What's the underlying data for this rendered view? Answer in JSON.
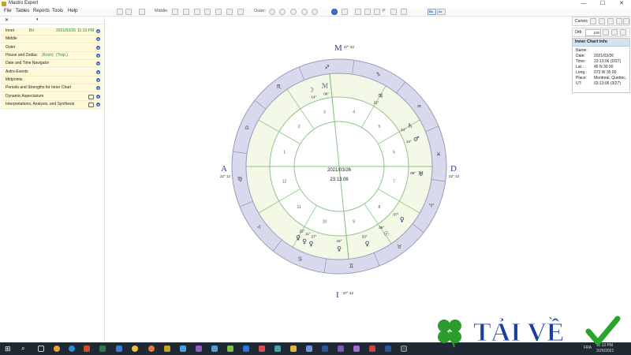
{
  "window": {
    "title": "Mastro Expert",
    "controls": [
      "—",
      "☐",
      "✕"
    ]
  },
  "menu": [
    "File",
    "Tables",
    "Reports",
    "Tools",
    "Help"
  ],
  "toolbar": {
    "middle_label": "Middle:",
    "outer_label": "Outer:",
    "page_label": "P",
    "zoom_a": "Bs",
    "zoom_b": "Ac"
  },
  "left_panel": {
    "tabs": [
      "✕",
      "◐"
    ],
    "inner": {
      "label": "Inner",
      "tag": "Brl",
      "date": "2021/03/26",
      "time": "11:13 PM"
    },
    "sections": [
      {
        "label": "Middle"
      },
      {
        "label": "Outer"
      },
      {
        "label": "House and Zodiac",
        "extra1": "(Koch)",
        "extra2": "(Trop.)"
      },
      {
        "label": "Date and Time Navigator"
      },
      {
        "label": "Astro-Events"
      },
      {
        "label": "Midpoints"
      },
      {
        "label": "Periods and Strengths for Inner Chart"
      },
      {
        "label": "Dynamic Aspectarium"
      },
      {
        "label": "Interpretations, Analysis, and Synthesis"
      }
    ]
  },
  "chart": {
    "center_date": "2021/03/26",
    "center_time": "23:13:06",
    "angles": {
      "mc": "27° 42",
      "asc": "22° 12",
      "dsc": "22° 12",
      "ic": "27° 42"
    },
    "house_numbers": [
      "1",
      "2",
      "3",
      "4",
      "5",
      "6",
      "7",
      "8",
      "9",
      "10",
      "11",
      "12"
    ],
    "cusp_labels": [
      "13",
      "15",
      "27°",
      "15°",
      "19°",
      "16°",
      "27°",
      "27°",
      "22°",
      "17°",
      "16°",
      "22°"
    ],
    "planets": [
      {
        "label": "ℳ",
        "degree": "06°"
      },
      {
        "label": "☽",
        "degree": "14°"
      },
      {
        "label": "♃",
        "degree": "22°"
      },
      {
        "label": "♄",
        "degree": "14°"
      },
      {
        "label": "♂",
        "degree": "14°"
      },
      {
        "label": "♅",
        "degree": "09°"
      },
      {
        "label": "♀",
        "degree": "07°"
      },
      {
        "label": "☉",
        "degree": "06°"
      },
      {
        "label": "♀",
        "degree": "23°"
      },
      {
        "label": "♀",
        "degree": "16°"
      },
      {
        "label": "♀",
        "degree": "27°"
      },
      {
        "label": "♀",
        "degree": "11°"
      },
      {
        "label": "♀",
        "degree": "22°"
      }
    ]
  },
  "right_panel": {
    "curves_label": "Curves",
    "orb_label": "Orb",
    "orb_value": "100",
    "info_title": "Inner Chart Info",
    "info": [
      {
        "k": "Name:",
        "v": ""
      },
      {
        "k": "Date:",
        "v": "2021/03/26"
      },
      {
        "k": "Time:",
        "v": "23:13:06 (DST)"
      },
      {
        "k": "Lat.:",
        "v": "45 N 30 00"
      },
      {
        "k": "Long.:",
        "v": "073 W 35 00"
      },
      {
        "k": "Place:",
        "v": "Montreal, Quebec,"
      },
      {
        "k": "UT:",
        "v": "03:13:06 (3/27)"
      }
    ]
  },
  "taskbar": {
    "lang": "FRA",
    "clock_time": "11:13 PM",
    "clock_date": "3/26/2021"
  },
  "watermark": {
    "text": "TẢI VỀ"
  },
  "colors": {
    "zodiac_ring": "#d9d9ee",
    "house_fill": "#f4f8e6",
    "line_green": "#8ec58a",
    "angle_blue": "#2b3f8f",
    "taskbar": "#1f2933"
  }
}
